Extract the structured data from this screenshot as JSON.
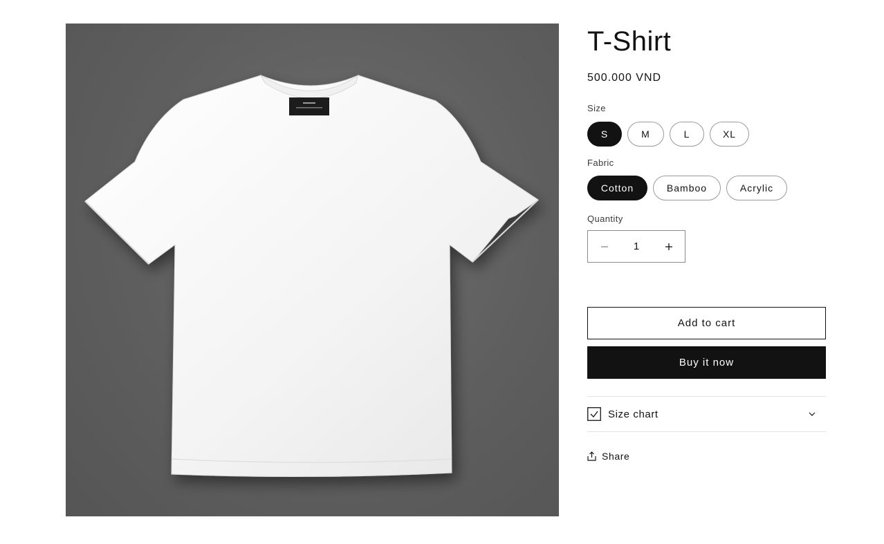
{
  "product": {
    "title": "T-Shirt",
    "price": "500.000 VND",
    "image_icon": "tshirt-image"
  },
  "options": {
    "size": {
      "label": "Size",
      "values": [
        "S",
        "M",
        "L",
        "XL"
      ],
      "selected": "S"
    },
    "fabric": {
      "label": "Fabric",
      "values": [
        "Cotton",
        "Bamboo",
        "Acrylic"
      ],
      "selected": "Cotton"
    }
  },
  "quantity": {
    "label": "Quantity",
    "value": "1",
    "decrease_icon": "minus-icon",
    "increase_icon": "plus-icon"
  },
  "actions": {
    "add_to_cart": "Add to cart",
    "buy_now": "Buy it now"
  },
  "collapsible": {
    "label": "Size chart",
    "icon": "checkbox-icon",
    "toggle_icon": "chevron-down-icon"
  },
  "share": {
    "label": "Share",
    "icon": "share-icon"
  },
  "colors": {
    "primary": "#121212",
    "background": "#ffffff",
    "border": "#9a9a9a"
  }
}
